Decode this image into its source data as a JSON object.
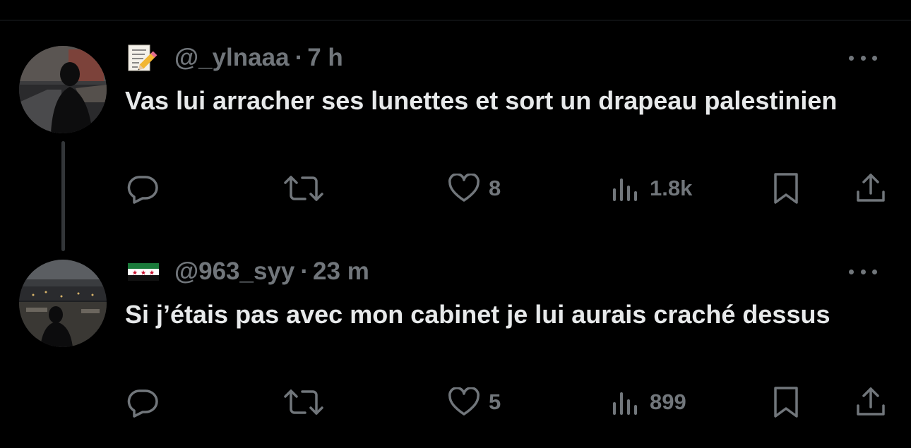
{
  "tweets": [
    {
      "emoji_icon": "memo-emoji",
      "handle": "@_ylnaaa",
      "separator": "·",
      "time": "7 h",
      "text": "Vas lui arracher ses lunettes et sort un drapeau palestinien",
      "likes": "8",
      "views": "1.8k"
    },
    {
      "emoji_icon": "syria-flag-emoji",
      "handle": "@963_syy",
      "separator": "·",
      "time": "23 m",
      "text": "Si j’étais pas avec mon cabinet je lui aurais craché dessus",
      "likes": "5",
      "views": "899"
    }
  ],
  "colors": {
    "background": "#000000",
    "text": "#e7e9ea",
    "secondary": "#71767b",
    "thread_line": "#333639"
  }
}
